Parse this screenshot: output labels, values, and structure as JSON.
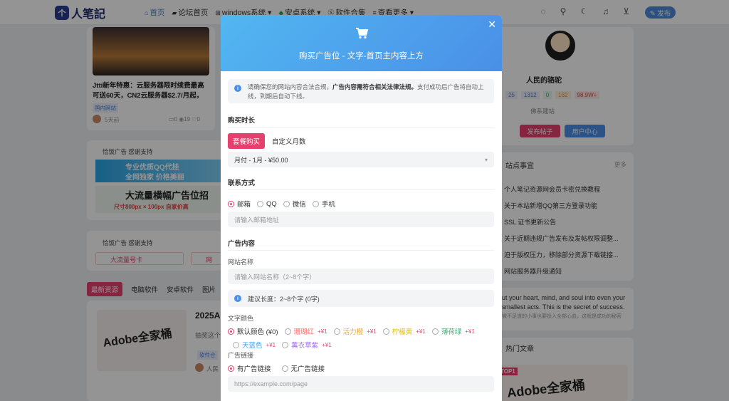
{
  "header": {
    "logo_badge": "个",
    "logo": "人笔記",
    "nav": [
      {
        "label": "首页",
        "icon": "home-icon",
        "glyph": "⌂"
      },
      {
        "label": "论坛首页",
        "icon": "forum-icon",
        "glyph": "▰"
      },
      {
        "label": "windows系统 ▾",
        "icon": "windows-icon",
        "glyph": "⊞"
      },
      {
        "label": "安卓系统 ▾",
        "icon": "android-icon",
        "glyph": "◆"
      },
      {
        "label": "软件合集",
        "icon": "software-icon",
        "glyph": "Ⓢ"
      },
      {
        "label": "查看更多 ▾",
        "icon": "more-icon",
        "glyph": "≡"
      }
    ],
    "publish": "✎ 发布"
  },
  "background": {
    "article_title": "Jtti新年特惠：云服务器限时续费最高可送60天，CN2云服务器$2.7/月起，中...",
    "article_tag": "国内网站",
    "article_time": "5天前",
    "article_stats": "▭0 ◉19 ♡0",
    "ad_label_1": "恰饭广告 感谢支持",
    "banner_qq_1": "专业优质QQ代挂",
    "banner_qq_2": "全网独家 价格美丽",
    "banner_big": "大流量横幅广告位招",
    "banner_size": "尺寸800px × 100px  自家价高",
    "ad_label_2": "恰饭广告 感谢支持",
    "link_1": "大流量号卡",
    "link_2": "网",
    "tabs": [
      "最新资源",
      "电脑软件",
      "安卓软件",
      "图片"
    ],
    "post_title": "2025A",
    "post_excerpt": "抽奖这个",
    "post_tag": "软件合",
    "post_author": "人民",
    "adobe_text": "Adobe全家桶",
    "user_name": "人民的骆驼",
    "user_stats": [
      "25",
      "1312",
      "0",
      "132",
      "98.9W+"
    ],
    "user_sub": "佛系建站",
    "btn_post": "发布帖子",
    "btn_center": "用户中心",
    "notice_title": "站点事宜",
    "notice_more": "更多",
    "notices": [
      "个人笔记资源网会员卡密兑换教程",
      "关于本站新增QQ第三方登录功能",
      "SSL 证书更新公告",
      "关于近期违规广告发布及发帖权限调整...",
      "迫于版权压力，移除部分资源下载链接...",
      "网站服务器升级通知"
    ],
    "quote_1": "ut your heart, mind, and soul into even your",
    "quote_2": "smallest acts. This is the secret of success.",
    "quote_3": "微不足道的小事也要投入全部心血，这就是成功的秘密",
    "hot_title": "热门文章",
    "hot_text": "Adobe全家桶",
    "hot_badge": "TOP1"
  },
  "modal": {
    "title": "购买广告位 - 文字-首页主内容上方",
    "notice_1": "请确保您的网站内容合法合规，",
    "notice_bold": "广告内容需符合相关法律法规。",
    "notice_2": "支付成功后广告将自动上线，到期后自动下线。",
    "section_duration": "购买时长",
    "tab_package": "套餐购买",
    "tab_custom": "自定义月数",
    "plan_select": "月付 - 1月 - ¥50.00",
    "section_contact": "联系方式",
    "contact_options": [
      "邮箱",
      "QQ",
      "微信",
      "手机"
    ],
    "contact_placeholder": "请输入邮箱地址",
    "section_content": "广告内容",
    "label_site_name": "网站名称",
    "site_name_placeholder": "请输入网站名称（2~8个字）",
    "hint": "建议长度：2~8个字 (0字)",
    "label_color": "文字颜色",
    "colors": [
      {
        "label": "默认颜色 (¥0)",
        "price": "",
        "color": "#333333"
      },
      {
        "label": "珊瑚红",
        "price": "+¥1",
        "color": "#ff6b6b"
      },
      {
        "label": "活力橙",
        "price": "+¥1",
        "color": "#f5a623"
      },
      {
        "label": "柠檬黄",
        "price": "+¥1",
        "color": "#e6c200"
      },
      {
        "label": "薄荷绿",
        "price": "+¥1",
        "color": "#2eb872"
      },
      {
        "label": "天蓝色",
        "price": "+¥1",
        "color": "#3aa0ff"
      },
      {
        "label": "薰衣草紫",
        "price": "+¥1",
        "color": "#a56cf0"
      }
    ],
    "label_link": "广告链接",
    "link_options": [
      "有广告链接",
      "无广告链接"
    ],
    "link_placeholder": "https://example.com/page"
  }
}
